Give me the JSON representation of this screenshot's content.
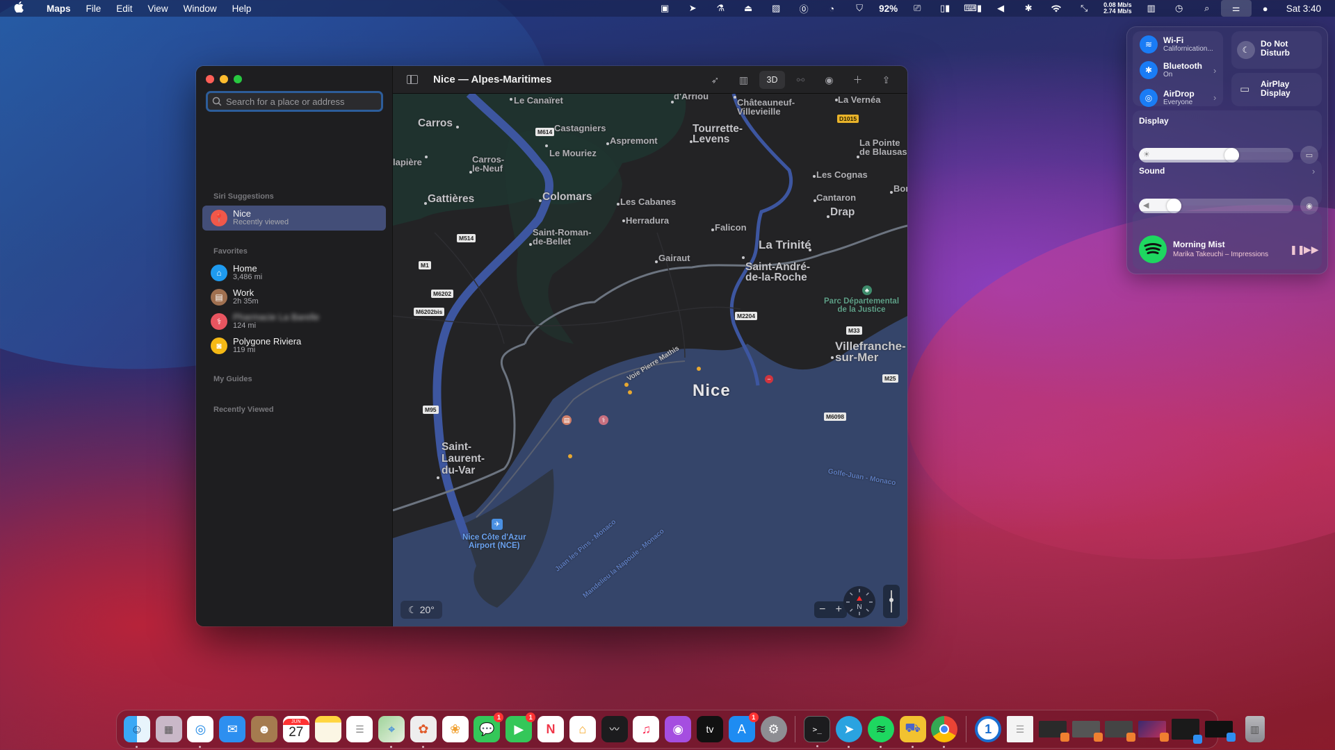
{
  "menubar": {
    "app_name": "Maps",
    "menus": [
      "File",
      "Edit",
      "View",
      "Window",
      "Help"
    ],
    "status_icons": [
      "display-icon",
      "location-arrow-icon",
      "flask-icon",
      "airplay-tray-icon",
      "display-sleep-icon",
      "1password-icon",
      "speed-gauge-icon",
      "shield-icon"
    ],
    "battery_percent": "92%",
    "net_up": "0.08 Mb/s",
    "net_down": "2.74 Mb/s",
    "clock": "Sat 3:40"
  },
  "window": {
    "title": "Nice — Alpes-Maritimes",
    "search": {
      "placeholder": "Search for a place or address",
      "value": ""
    },
    "sections": {
      "siri": "Siri Suggestions",
      "favorites": "Favorites",
      "guides": "My Guides",
      "recent": "Recently Viewed"
    },
    "siri_items": [
      {
        "name": "Nice",
        "sub": "Recently viewed",
        "icon": "pin-icon",
        "color": "#f0584a"
      }
    ],
    "favorites": [
      {
        "name": "Home",
        "sub": "3,486 mi",
        "icon": "house-icon",
        "color": "#1e9bf0"
      },
      {
        "name": "Work",
        "sub": "2h 35m",
        "icon": "briefcase-icon",
        "color": "#a07050"
      },
      {
        "name": "Pharmacie La Barelle",
        "sub": "124 mi",
        "icon": "stethoscope-icon",
        "color": "#e85560",
        "blurred": true
      },
      {
        "name": "Polygone Riviera",
        "sub": "119 mi",
        "icon": "shopping-bag-icon",
        "color": "#f5b915"
      }
    ],
    "toolbar": {
      "three_d_label": "3D",
      "buttons": [
        "location-icon",
        "map-mode-icon",
        "3d",
        "look-around-icon",
        "tracking-icon",
        "add-icon",
        "share-icon"
      ]
    },
    "map": {
      "temperature": "20°",
      "compass_label": "N",
      "zoom_out": "−",
      "zoom_in": "+",
      "labels": {
        "le_canairet": "Le Canaïret",
        "darriou": "d'Arriou",
        "chateauneuf": "Châteauneuf-\nVillevieille",
        "la_vernea": "La Vernéa",
        "carros": "Carros",
        "castagniers": "Castagniers",
        "aspremont": "Aspremont",
        "le_mouriez": "Le Mouriez",
        "tourrette": "Tourrette-\nLevens",
        "la_pointe": "La Pointe\nde Blausasc",
        "lapiere": "lapière",
        "carros_neuf": "Carros-\nle-Neuf",
        "les_cognas": "Les Cognas",
        "bon": "Bor",
        "gattieres": "Gattières",
        "colomars": "Colomars",
        "les_cabanes": "Les Cabanes",
        "cantaron": "Cantaron",
        "drap": "Drap",
        "herradura": "Herradura",
        "falicon": "Falicon",
        "saint_roman": "Saint-Roman-\nde-Bellet",
        "la_trinite": "La Trinité",
        "gairaut": "Gairaut",
        "saint_andre": "Saint-André-\nde-la-Roche",
        "parc": "Parc Départemental\nde la Justice",
        "villefranche": "Villefranche-\nsur-Mer",
        "voie": "Voie Pierre Mathis",
        "nice": "Nice",
        "saint_laurent": "Saint-\nLaurent-\ndu-Var",
        "airport": "Nice Côte d'Azur\nAirport (NCE)",
        "golfe": "Golfe-Juan - Monaco",
        "juan": "Juan les Pins - Monaco",
        "mandelieu": "Mandelieu la Napoule - Monaco"
      },
      "roads": {
        "m614": "M614",
        "d1015": "D1015",
        "m514": "M514",
        "m1": "M1",
        "m6202": "M6202",
        "m6202bis": "M6202bis",
        "m2204": "M2204",
        "m33": "M33",
        "m25": "M25",
        "m95": "M95",
        "m6098": "M6098"
      }
    }
  },
  "control_center": {
    "wifi": {
      "title": "Wi-Fi",
      "sub": "Californication..."
    },
    "bluetooth": {
      "title": "Bluetooth",
      "sub": "On"
    },
    "airdrop": {
      "title": "AirDrop",
      "sub": "Everyone"
    },
    "dnd": "Do Not\nDisturb",
    "airplay": "AirPlay\nDisplay",
    "display": {
      "label": "Display",
      "brightness": 0.61
    },
    "sound": {
      "label": "Sound",
      "volume": 0.2
    },
    "now_playing": {
      "title": "Morning Mist",
      "artist": "Marika Takeuchi – Impressions"
    }
  },
  "dock": {
    "apps": [
      {
        "name": "Finder",
        "icon": "finder-icon",
        "running": true
      },
      {
        "name": "Launchpad",
        "icon": "launchpad-icon"
      },
      {
        "name": "Safari",
        "icon": "safari-icon",
        "running": true
      },
      {
        "name": "Mail",
        "icon": "mail-icon"
      },
      {
        "name": "Contacts",
        "icon": "contacts-icon"
      },
      {
        "name": "Calendar",
        "icon": "calendar-icon",
        "month": "JUN",
        "day": "27"
      },
      {
        "name": "Notes",
        "icon": "notes-icon"
      },
      {
        "name": "Reminders",
        "icon": "reminders-icon"
      },
      {
        "name": "Maps",
        "icon": "maps-icon",
        "running": true
      },
      {
        "name": "Pixelmator",
        "icon": "pixelmator-icon",
        "running": true
      },
      {
        "name": "Photos",
        "icon": "photos-icon"
      },
      {
        "name": "Messages",
        "icon": "messages-icon",
        "badge": "1"
      },
      {
        "name": "FaceTime",
        "icon": "facetime-icon",
        "badge": "1"
      },
      {
        "name": "News",
        "icon": "news-icon"
      },
      {
        "name": "Home",
        "icon": "home-app-icon"
      },
      {
        "name": "Stocks",
        "icon": "stocks-icon"
      },
      {
        "name": "Music",
        "icon": "music-icon"
      },
      {
        "name": "Podcasts",
        "icon": "podcasts-icon"
      },
      {
        "name": "TV",
        "icon": "tv-icon",
        "label": "tv"
      },
      {
        "name": "App Store",
        "icon": "app-store-icon",
        "badge": "1"
      },
      {
        "name": "System Preferences",
        "icon": "system-preferences-icon"
      }
    ],
    "apps2": [
      {
        "name": "Terminal",
        "icon": "terminal-icon",
        "running": true
      },
      {
        "name": "Telegram",
        "icon": "telegram-icon",
        "running": true
      },
      {
        "name": "Spotify",
        "icon": "spotify-icon",
        "running": true
      },
      {
        "name": "Transmit",
        "icon": "transmit-icon",
        "running": true
      },
      {
        "name": "Chrome",
        "icon": "chrome-icon",
        "running": true
      }
    ],
    "trash": "Trash"
  }
}
